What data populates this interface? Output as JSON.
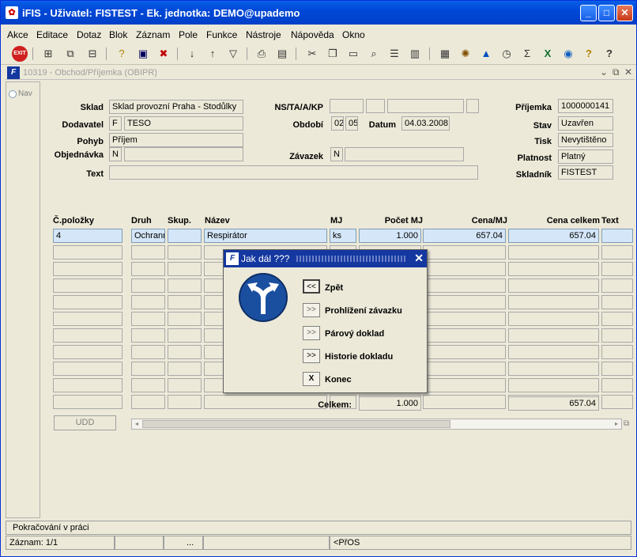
{
  "window": {
    "title": "iFIS - Uživatel: FISTEST - Ek. jednotka: DEMO@upademo"
  },
  "menu": [
    "Akce",
    "Editace",
    "Dotaz",
    "Blok",
    "Záznam",
    "Pole",
    "Funkce",
    "Nástroje",
    "Nápověda",
    "Okno"
  ],
  "toolbar_icons": [
    "exit-icon",
    "insert-record-icon",
    "duplicate-icon",
    "delete-icon",
    "query-icon",
    "execute-query-icon",
    "cancel-query-icon",
    "sort-asc-icon",
    "sort-desc-icon",
    "filter-icon",
    "print-icon",
    "cut-icon",
    "copy-icon",
    "paste-icon",
    "find-icon",
    "list-icon",
    "tree-icon",
    "calculator-icon",
    "settings-icon",
    "warning-icon",
    "clock-icon",
    "sum-icon",
    "excel-icon",
    "refresh-icon",
    "help-icon",
    "about-icon"
  ],
  "exit_label": "EXIT",
  "child": {
    "title": "10319 - Obchod/Příjemka (OBIPR)"
  },
  "nav": {
    "label": "Nav"
  },
  "header": {
    "sklad_label": "Sklad",
    "sklad_value": "Sklad provozní Praha - Stodůlky",
    "dodavatel_label": "Dodavatel",
    "dodavatel_type": "F",
    "dodavatel_value": "TESO",
    "pohyb_label": "Pohyb",
    "pohyb_value": "Příjem",
    "objednavka_label": "Objednávka",
    "objednavka_flag": "N",
    "objednavka_value": "",
    "text_label": "Text",
    "text_value": "",
    "nsta_label": "NS/TA/A/KP",
    "obdobi_label": "Období",
    "obdobi_1": "02",
    "obdobi_2": "05",
    "datum_label": "Datum",
    "datum_value": "04.03.2008",
    "zavazek_label": "Závazek",
    "zavazek_flag": "N",
    "zavazek_value": "",
    "prijemka_label": "Příjemka",
    "prijemka_value": "1000000141",
    "stav_label": "Stav",
    "stav_value": "Uzavřen",
    "tisk_label": "Tisk",
    "tisk_value": "Nevytištěno",
    "platnost_label": "Platnost",
    "platnost_value": "Platný",
    "skladnik_label": "Skladník",
    "skladnik_value": "FISTEST"
  },
  "grid": {
    "headers": {
      "polozky": "Č.položky",
      "druh": "Druh",
      "skup": "Skup.",
      "nazev": "Název",
      "mj": "MJ",
      "pocet": "Počet MJ",
      "cena": "Cena/MJ",
      "celkem": "Cena celkem",
      "text": "Text"
    },
    "row1": {
      "polozky": "4",
      "druh": "Ochranné",
      "skup": "",
      "nazev": "Respirátor",
      "mj": "ks",
      "pocet": "1.000",
      "cena": "657.04",
      "celkem": "657.04"
    },
    "celkem_label": "Celkem:",
    "celkem_pocet": "1.000",
    "celkem_cena": "657.04"
  },
  "udd_button": "UDD",
  "dialog": {
    "title": "Jak dál ???",
    "options": [
      {
        "btn": "<<",
        "label": "Zpět"
      },
      {
        "btn": ">>",
        "label": "Prohlížení závazku"
      },
      {
        "btn": ">>",
        "label": "Párový doklad"
      },
      {
        "btn": ">>",
        "label": "Historie dokladu"
      },
      {
        "btn": "X",
        "label": "Konec"
      }
    ]
  },
  "status": {
    "message": "Pokračování v práci",
    "record": "Záznam: 1/1",
    "dots": "...",
    "mode": "<PřOS"
  }
}
